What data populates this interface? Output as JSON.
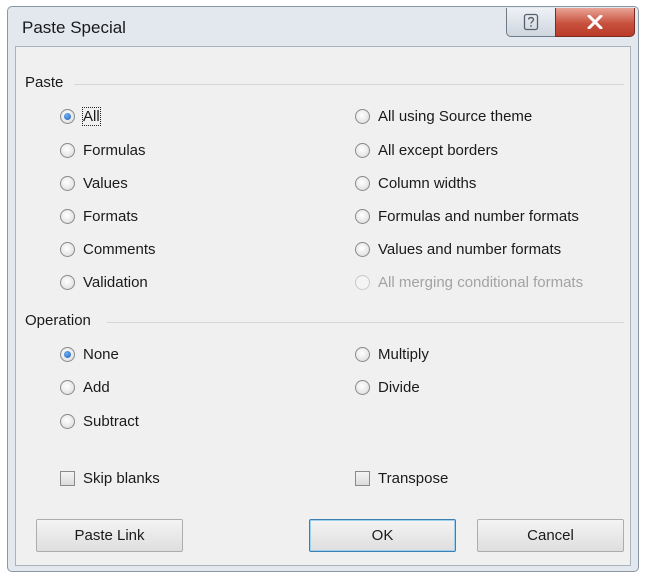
{
  "window": {
    "title": "Paste Special",
    "help_icon": "question-mark-icon",
    "close_icon": "close-x-icon"
  },
  "paste": {
    "group_label": "Paste",
    "left": [
      {
        "label": "All",
        "selected": true
      },
      {
        "label": "Formulas",
        "selected": false
      },
      {
        "label": "Values",
        "selected": false
      },
      {
        "label": "Formats",
        "selected": false
      },
      {
        "label": "Comments",
        "selected": false
      },
      {
        "label": "Validation",
        "selected": false
      }
    ],
    "right": [
      {
        "label": "All using Source theme",
        "selected": false
      },
      {
        "label": "All except borders",
        "selected": false
      },
      {
        "label": "Column widths",
        "selected": false
      },
      {
        "label": "Formulas and number formats",
        "selected": false
      },
      {
        "label": "Values and number formats",
        "selected": false
      },
      {
        "label": "All merging conditional formats",
        "selected": false,
        "disabled": true
      }
    ]
  },
  "operation": {
    "group_label": "Operation",
    "left": [
      {
        "label": "None",
        "selected": true
      },
      {
        "label": "Add",
        "selected": false
      },
      {
        "label": "Subtract",
        "selected": false
      }
    ],
    "right": [
      {
        "label": "Multiply",
        "selected": false
      },
      {
        "label": "Divide",
        "selected": false
      }
    ]
  },
  "checkboxes": {
    "skip_blanks": {
      "label": "Skip blanks",
      "checked": false
    },
    "transpose": {
      "label": "Transpose",
      "checked": false
    }
  },
  "buttons": {
    "paste_link": "Paste Link",
    "ok": "OK",
    "cancel": "Cancel"
  },
  "colors": {
    "selected_dot": "#1c5fb8",
    "close_button": "#c8513e",
    "default_button_border": "#3c7fb1"
  }
}
